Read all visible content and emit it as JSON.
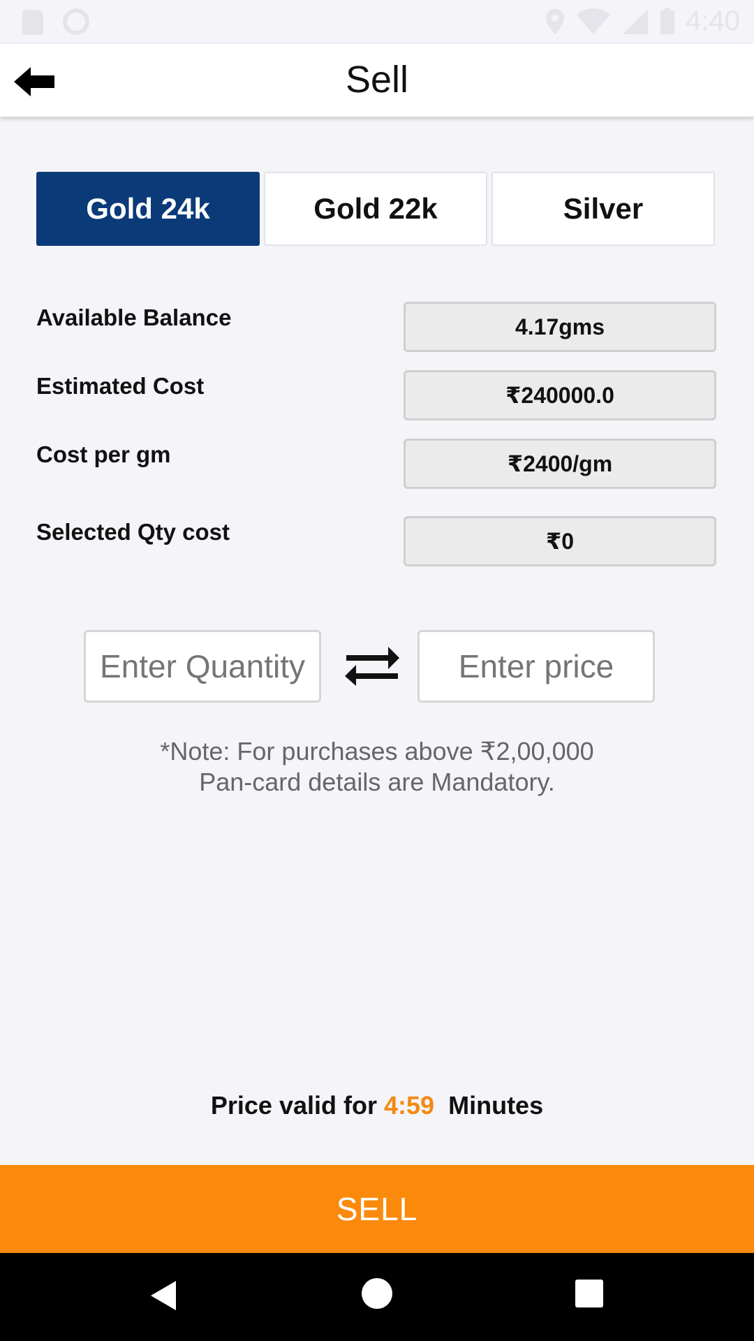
{
  "status_bar": {
    "time": "4:40"
  },
  "app_bar": {
    "title": "Sell"
  },
  "tabs": [
    {
      "label": "Gold 24k",
      "active": true
    },
    {
      "label": "Gold 22k",
      "active": false
    },
    {
      "label": "Silver",
      "active": false
    }
  ],
  "details": {
    "available_balance": {
      "label": "Available Balance",
      "value": "4.17gms"
    },
    "estimated_cost": {
      "label": "Estimated Cost",
      "value": "₹240000.0"
    },
    "cost_per_gm": {
      "label": "Cost per gm",
      "value": "₹2400/gm"
    },
    "selected_qty_cost": {
      "label": "Selected Qty cost",
      "value": "₹0"
    }
  },
  "inputs": {
    "quantity": {
      "placeholder": "Enter Quantity",
      "value": ""
    },
    "price": {
      "placeholder": "Enter price",
      "value": ""
    }
  },
  "note": {
    "line1": "*Note: For purchases above ₹2,00,000",
    "line2": "Pan-card details are Mandatory."
  },
  "validity": {
    "prefix": "Price valid for",
    "timer": "4:59",
    "suffix": "Minutes"
  },
  "sell_button": {
    "label": "SELL"
  },
  "colors": {
    "primary": "#0b3a78",
    "accent": "#fb8a0c",
    "timer": "#f28a12"
  },
  "icons": {
    "back": "arrow-left-icon",
    "swap": "swap-arrows-icon"
  }
}
